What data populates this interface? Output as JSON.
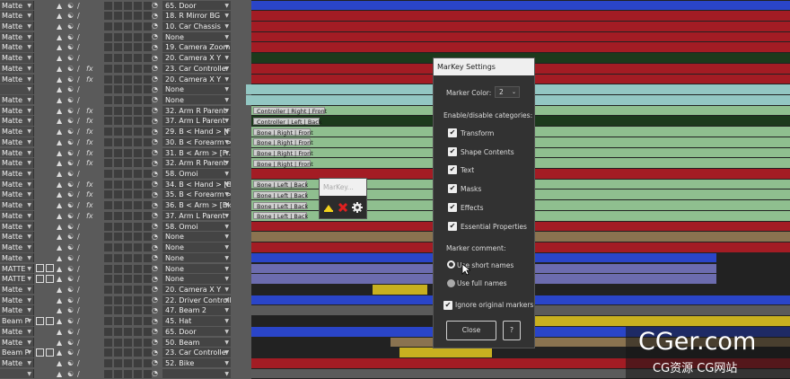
{
  "layers": [
    {
      "mode": "Matte",
      "name": "65. Door",
      "fx": false,
      "sw": "m"
    },
    {
      "mode": "Matte",
      "name": "18. R Mirror BG",
      "fx": false,
      "sw": "m"
    },
    {
      "mode": "Matte",
      "name": "10. Car Chassis",
      "fx": false,
      "sw": "m"
    },
    {
      "mode": "Matte",
      "name": "None",
      "fx": false,
      "sw": "m"
    },
    {
      "mode": "Matte",
      "name": "19. Camera Zoom",
      "fx": false,
      "sw": "m"
    },
    {
      "mode": "Matte",
      "name": "20. Camera X Y",
      "fx": false,
      "sw": "m"
    },
    {
      "mode": "Matte",
      "name": "23. Car Controller",
      "fx": true,
      "sw": "m"
    },
    {
      "mode": "Matte",
      "name": "20. Camera X Y",
      "fx": true,
      "sw": "m"
    },
    {
      "mode": "",
      "name": "None",
      "fx": false,
      "sw": "m"
    },
    {
      "mode": "Matte",
      "name": "None",
      "fx": false,
      "sw": "m"
    },
    {
      "mode": "Matte",
      "name": "32. Arm R Parent",
      "fx": true,
      "sw": "m"
    },
    {
      "mode": "Matte",
      "name": "37. Arm L Parent",
      "fx": true,
      "sw": "m"
    },
    {
      "mode": "Matte",
      "name": "29. B < Hand > [Fr.R",
      "fx": true,
      "sw": "m"
    },
    {
      "mode": "Matte",
      "name": "30. B < Forearm > [",
      "fx": true,
      "sw": "m"
    },
    {
      "mode": "Matte",
      "name": "31. B < Arm > [Fr.R",
      "fx": true,
      "sw": "m"
    },
    {
      "mode": "Matte",
      "name": "32. Arm R Parent",
      "fx": true,
      "sw": "m"
    },
    {
      "mode": "Matte",
      "name": "58. Omoi",
      "fx": false,
      "sw": "m"
    },
    {
      "mode": "Matte",
      "name": "34. B < Hand > [Bk.",
      "fx": true,
      "sw": "m"
    },
    {
      "mode": "Matte",
      "name": "35. B < Forearm > [",
      "fx": true,
      "sw": "m"
    },
    {
      "mode": "Matte",
      "name": "36. B < Arm > [Bk.L",
      "fx": true,
      "sw": "m"
    },
    {
      "mode": "Matte",
      "name": "37. Arm L Parent",
      "fx": true,
      "sw": "m"
    },
    {
      "mode": "Matte",
      "name": "58. Omoi",
      "fx": false,
      "sw": "m"
    },
    {
      "mode": "Matte",
      "name": "None",
      "fx": false,
      "sw": "m"
    },
    {
      "mode": "Matte",
      "name": "None",
      "fx": false,
      "sw": "m"
    },
    {
      "mode": "Matte",
      "name": "None",
      "fx": false,
      "sw": "m"
    },
    {
      "mode": "MATTE",
      "name": "None",
      "fx": false,
      "sw": "b"
    },
    {
      "mode": "MATTE",
      "name": "None",
      "fx": false,
      "sw": "b"
    },
    {
      "mode": "Matte",
      "name": "20. Camera X Y",
      "fx": false,
      "sw": "m"
    },
    {
      "mode": "Matte",
      "name": "22. Driver Controlle",
      "fx": false,
      "sw": "m"
    },
    {
      "mode": "Matte",
      "name": "47. Beam 2",
      "fx": false,
      "sw": "m"
    },
    {
      "mode": "Beam P",
      "name": "45. Hat",
      "fx": false,
      "sw": "b"
    },
    {
      "mode": "Matte",
      "name": "65. Door",
      "fx": false,
      "sw": "m"
    },
    {
      "mode": "Matte",
      "name": "50. Beam",
      "fx": false,
      "sw": "m"
    },
    {
      "mode": "Beam P",
      "name": "23. Car Controller",
      "fx": false,
      "sw": "b"
    },
    {
      "mode": "Matte",
      "name": "52. Bike",
      "fx": false,
      "sw": "m"
    },
    {
      "mode": "",
      "name": "",
      "fx": false,
      "sw": "m"
    }
  ],
  "tracks": [
    {
      "color": "#2a45c8",
      "start": 0,
      "end": 600
    },
    {
      "color": "#a31c24",
      "start": 0,
      "end": 600
    },
    {
      "color": "#a31c24",
      "start": 0,
      "end": 600
    },
    {
      "color": "#a31c24",
      "start": 0,
      "end": 600
    },
    {
      "color": "#a31c24",
      "start": 0,
      "end": 600
    },
    {
      "color": "#1c3a1c",
      "start": 0,
      "end": 600
    },
    {
      "color": "#a31c24",
      "start": 0,
      "end": 600
    },
    {
      "color": "#a31c24",
      "start": 0,
      "end": 600
    },
    {
      "color": "#93c7c3",
      "start": -6,
      "end": 600
    },
    {
      "color": "#93c7c3",
      "start": -6,
      "end": 600
    },
    {
      "color": "#8fbf8f",
      "start": 0,
      "end": 600
    },
    {
      "color": "#1c3a1c",
      "start": 0,
      "end": 600
    },
    {
      "color": "#8fbf8f",
      "start": 0,
      "end": 600
    },
    {
      "color": "#8fbf8f",
      "start": 0,
      "end": 600
    },
    {
      "color": "#8fbf8f",
      "start": 0,
      "end": 600
    },
    {
      "color": "#8fbf8f",
      "start": 0,
      "end": 600
    },
    {
      "color": "#a31c24",
      "start": 0,
      "end": 600
    },
    {
      "color": "#8fbf8f",
      "start": 0,
      "end": 600
    },
    {
      "color": "#8fbf8f",
      "start": 0,
      "end": 600
    },
    {
      "color": "#8fbf8f",
      "start": 0,
      "end": 600
    },
    {
      "color": "#8fbf8f",
      "start": 0,
      "end": 600
    },
    {
      "color": "#a31c24",
      "start": 0,
      "end": 600
    },
    {
      "color": "#8a7350",
      "start": 0,
      "end": 600
    },
    {
      "color": "#a31c24",
      "start": 0,
      "end": 600
    },
    {
      "color": "#2a45c8",
      "start": 0,
      "end": 518
    },
    {
      "color": "#6c6cae",
      "start": 0,
      "end": 518
    },
    {
      "color": "#6c6cae",
      "start": 0,
      "end": 518
    },
    {
      "color": "#c8b020",
      "start": 135,
      "end": 196
    },
    {
      "color": "#2a45c8",
      "start": 0,
      "end": 600
    },
    {
      "color": "#5b5b5b",
      "start": 0,
      "end": 600
    },
    {
      "color": "#c8b020",
      "start": 310,
      "end": 600
    },
    {
      "color": "#2a45c8",
      "start": 0,
      "end": 600
    },
    {
      "color": "#8a7350",
      "start": 155,
      "end": 600
    },
    {
      "color": "#c8b020",
      "start": 165,
      "end": 268
    },
    {
      "color": "#a31c24",
      "start": 0,
      "end": 600
    },
    {
      "color": "#5b5b5b",
      "start": 0,
      "end": 600
    }
  ],
  "markers": [
    {
      "row": 10,
      "text": "Controller | Right | Front",
      "width": 80
    },
    {
      "row": 11,
      "text": "Controller | Left | Back",
      "width": 74
    },
    {
      "row": 12,
      "text": "Bone | Right | Front",
      "width": 64
    },
    {
      "row": 13,
      "text": "Bone | Right | Front",
      "width": 64
    },
    {
      "row": 14,
      "text": "Bone | Right | Front",
      "width": 64
    },
    {
      "row": 15,
      "text": "Bone | Right | Front",
      "width": 64
    },
    {
      "row": 17,
      "text": "Bone | Left | Back",
      "width": 60
    },
    {
      "row": 18,
      "text": "Bone | Left | Back",
      "width": 60
    },
    {
      "row": 19,
      "text": "Bone | Left | Back",
      "width": 60
    },
    {
      "row": 20,
      "text": "Bone | Left | Back",
      "width": 60
    }
  ],
  "dialog": {
    "title": "MarKey Settings",
    "marker_color_label": "Marker Color:",
    "marker_color_value": "2",
    "categories_label": "Enable/disable categories:",
    "categories": [
      "Transform",
      "Shape Contents",
      "Text",
      "Masks",
      "Effects",
      "Essential Properties"
    ],
    "comment_label": "Marker comment:",
    "option_short": "Use short names",
    "option_full": "Use full names",
    "ignore_label": "Ignore original markers",
    "close_label": "Close",
    "help_label": "?"
  },
  "mini_panel": {
    "title": "MarKey..."
  },
  "watermark": {
    "line1": "CGer.com",
    "line2": "CG资源 CG网站"
  }
}
